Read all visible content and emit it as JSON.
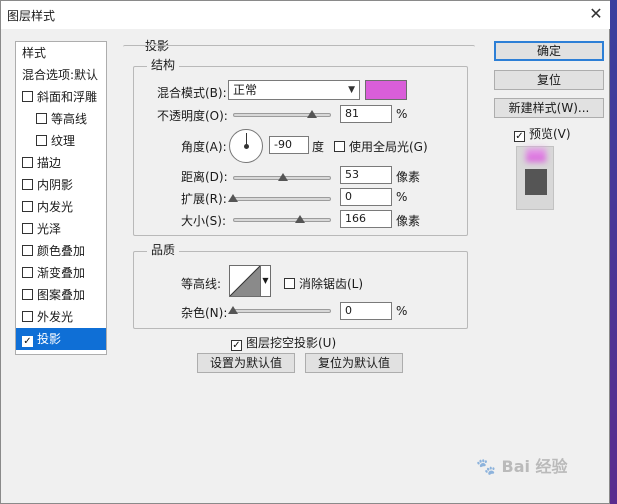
{
  "window": {
    "title": "图层样式",
    "close_glyph": "✕"
  },
  "style_list": {
    "header": "样式",
    "blend_options": "混合选项:默认",
    "items": [
      {
        "label": "斜面和浮雕",
        "checked": false,
        "indent": false
      },
      {
        "label": "等高线",
        "checked": false,
        "indent": true
      },
      {
        "label": "纹理",
        "checked": false,
        "indent": true
      },
      {
        "label": "描边",
        "checked": false,
        "indent": false
      },
      {
        "label": "内阴影",
        "checked": false,
        "indent": false
      },
      {
        "label": "内发光",
        "checked": false,
        "indent": false
      },
      {
        "label": "光泽",
        "checked": false,
        "indent": false
      },
      {
        "label": "颜色叠加",
        "checked": false,
        "indent": false
      },
      {
        "label": "渐变叠加",
        "checked": false,
        "indent": false
      },
      {
        "label": "图案叠加",
        "checked": false,
        "indent": false
      },
      {
        "label": "外发光",
        "checked": false,
        "indent": false
      },
      {
        "label": "投影",
        "checked": true,
        "indent": false,
        "selected": true
      }
    ],
    "check_glyph": "✓"
  },
  "drop_shadow": {
    "section_title": "投影",
    "structure_title": "结构",
    "blend_mode_label": "混合模式(B):",
    "blend_mode_value": "正常",
    "shadow_color": "#d95ed9",
    "opacity_label": "不透明度(O):",
    "opacity_value": "81",
    "percent": "%",
    "opacity_fraction": 0.81,
    "angle_label": "角度(A):",
    "angle_value": "-90",
    "angle_unit": "度",
    "global_light_label": "使用全局光(G)",
    "global_light_checked": false,
    "distance_label": "距离(D):",
    "distance_value": "53",
    "spread_label": "扩展(R):",
    "spread_value": "0",
    "spread_fraction": 0.0,
    "size_label": "大小(S):",
    "size_value": "166",
    "pixel_unit": "像素",
    "quality_title": "品质",
    "contour_label": "等高线:",
    "antialias_label": "消除锯齿(L)",
    "antialias_checked": false,
    "noise_label": "杂色(N):",
    "noise_value": "0",
    "noise_fraction": 0.0,
    "knockout_label": "图层挖空投影(U)",
    "knockout_checked": true,
    "make_default_label": "设置为默认值",
    "reset_default_label": "复位为默认值"
  },
  "buttons": {
    "ok": "确定",
    "reset": "复位",
    "new_style": "新建样式(W)...",
    "preview_label": "预览(V)",
    "preview_checked": true
  },
  "watermark": {
    "text": "Bai 经验",
    "paw": "🐾"
  }
}
